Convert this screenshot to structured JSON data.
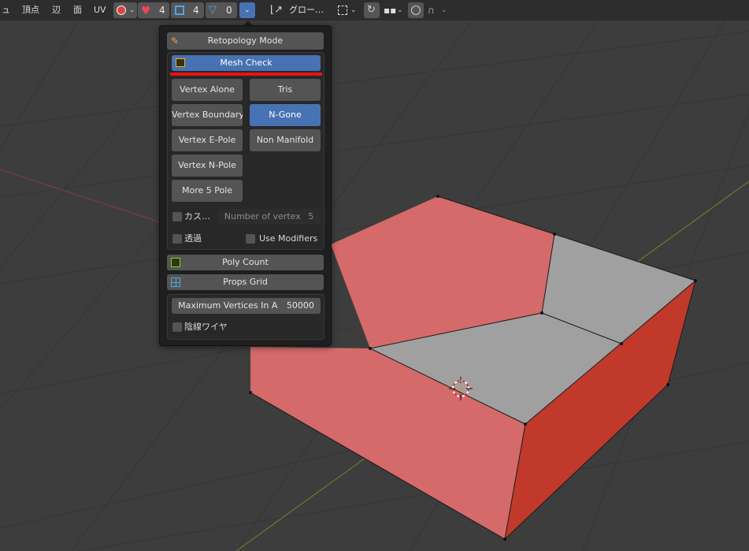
{
  "header": {
    "menus": [
      "ュ",
      "頂点",
      "辺",
      "面",
      "UV"
    ],
    "counts": {
      "faces_count": "4",
      "edges_count": "4",
      "verts_count": "0"
    },
    "transform_orientation": "グロー…"
  },
  "popup": {
    "retopology_mode_label": "Retopology Mode",
    "mesh_check_label": "Mesh Check",
    "buttons": {
      "vertex_alone": "Vertex Alone",
      "tris": "Tris",
      "vertex_boundary": "Vertex Boundary",
      "n_gone": "N-Gone",
      "vertex_e_pole": "Vertex E-Pole",
      "non_manifold": "Non Manifold",
      "vertex_n_pole": "Vertex N-Pole",
      "more_5_pole": "More 5 Pole"
    },
    "custom_label": "カス…",
    "number_of_vertex_label": "Number of vertex",
    "number_of_vertex_value": "5",
    "xray_label": "透過",
    "use_modifiers_label": "Use Modifiers",
    "poly_count_label": "Poly Count",
    "props_grid_label": "Props Grid",
    "max_vertices_label": "Maximum Vertices In A",
    "max_vertices_value": "50000",
    "hidden_wire_label": "陰線ワイヤ"
  },
  "colors": {
    "accent_blue": "#4772b3",
    "highlight_red": "#e81414",
    "face_red": "#d46a6a",
    "face_red_dark": "#c0392b",
    "face_gray": "#a0a0a0"
  }
}
